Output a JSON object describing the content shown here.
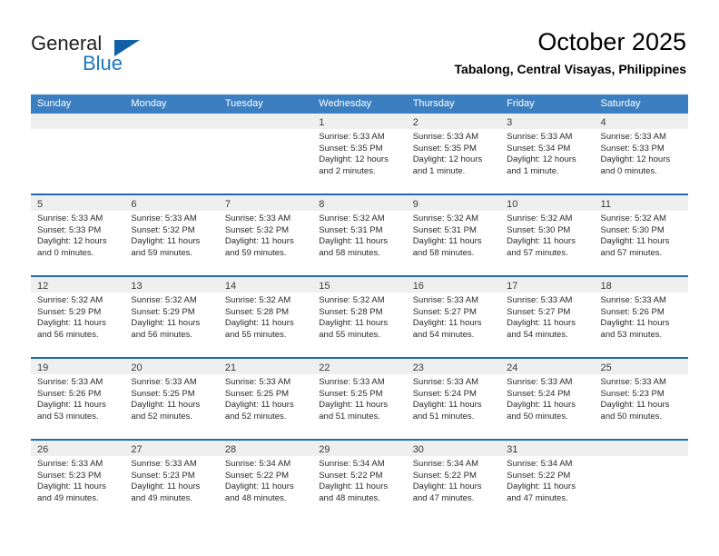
{
  "brand": {
    "name_part1": "General",
    "name_part2": "Blue",
    "triangle_color": "#1260a8",
    "blue_color": "#1c79c0"
  },
  "header": {
    "month_title": "October 2025",
    "location": "Tabalong, Central Visayas, Philippines"
  },
  "theme": {
    "header_row_bg": "#3c7fc1",
    "week_border": "#1f6cb0",
    "daynum_bg": "#efefef"
  },
  "weekday_headers": [
    "Sunday",
    "Monday",
    "Tuesday",
    "Wednesday",
    "Thursday",
    "Friday",
    "Saturday"
  ],
  "weeks": [
    [
      {
        "day": "",
        "empty": true,
        "sunrise": "",
        "sunset": "",
        "daylight1": "",
        "daylight2": ""
      },
      {
        "day": "",
        "empty": true,
        "sunrise": "",
        "sunset": "",
        "daylight1": "",
        "daylight2": ""
      },
      {
        "day": "",
        "empty": true,
        "sunrise": "",
        "sunset": "",
        "daylight1": "",
        "daylight2": ""
      },
      {
        "day": "1",
        "empty": false,
        "sunrise": "Sunrise: 5:33 AM",
        "sunset": "Sunset: 5:35 PM",
        "daylight1": "Daylight: 12 hours",
        "daylight2": "and 2 minutes."
      },
      {
        "day": "2",
        "empty": false,
        "sunrise": "Sunrise: 5:33 AM",
        "sunset": "Sunset: 5:35 PM",
        "daylight1": "Daylight: 12 hours",
        "daylight2": "and 1 minute."
      },
      {
        "day": "3",
        "empty": false,
        "sunrise": "Sunrise: 5:33 AM",
        "sunset": "Sunset: 5:34 PM",
        "daylight1": "Daylight: 12 hours",
        "daylight2": "and 1 minute."
      },
      {
        "day": "4",
        "empty": false,
        "sunrise": "Sunrise: 5:33 AM",
        "sunset": "Sunset: 5:33 PM",
        "daylight1": "Daylight: 12 hours",
        "daylight2": "and 0 minutes."
      }
    ],
    [
      {
        "day": "5",
        "empty": false,
        "sunrise": "Sunrise: 5:33 AM",
        "sunset": "Sunset: 5:33 PM",
        "daylight1": "Daylight: 12 hours",
        "daylight2": "and 0 minutes."
      },
      {
        "day": "6",
        "empty": false,
        "sunrise": "Sunrise: 5:33 AM",
        "sunset": "Sunset: 5:32 PM",
        "daylight1": "Daylight: 11 hours",
        "daylight2": "and 59 minutes."
      },
      {
        "day": "7",
        "empty": false,
        "sunrise": "Sunrise: 5:33 AM",
        "sunset": "Sunset: 5:32 PM",
        "daylight1": "Daylight: 11 hours",
        "daylight2": "and 59 minutes."
      },
      {
        "day": "8",
        "empty": false,
        "sunrise": "Sunrise: 5:32 AM",
        "sunset": "Sunset: 5:31 PM",
        "daylight1": "Daylight: 11 hours",
        "daylight2": "and 58 minutes."
      },
      {
        "day": "9",
        "empty": false,
        "sunrise": "Sunrise: 5:32 AM",
        "sunset": "Sunset: 5:31 PM",
        "daylight1": "Daylight: 11 hours",
        "daylight2": "and 58 minutes."
      },
      {
        "day": "10",
        "empty": false,
        "sunrise": "Sunrise: 5:32 AM",
        "sunset": "Sunset: 5:30 PM",
        "daylight1": "Daylight: 11 hours",
        "daylight2": "and 57 minutes."
      },
      {
        "day": "11",
        "empty": false,
        "sunrise": "Sunrise: 5:32 AM",
        "sunset": "Sunset: 5:30 PM",
        "daylight1": "Daylight: 11 hours",
        "daylight2": "and 57 minutes."
      }
    ],
    [
      {
        "day": "12",
        "empty": false,
        "sunrise": "Sunrise: 5:32 AM",
        "sunset": "Sunset: 5:29 PM",
        "daylight1": "Daylight: 11 hours",
        "daylight2": "and 56 minutes."
      },
      {
        "day": "13",
        "empty": false,
        "sunrise": "Sunrise: 5:32 AM",
        "sunset": "Sunset: 5:29 PM",
        "daylight1": "Daylight: 11 hours",
        "daylight2": "and 56 minutes."
      },
      {
        "day": "14",
        "empty": false,
        "sunrise": "Sunrise: 5:32 AM",
        "sunset": "Sunset: 5:28 PM",
        "daylight1": "Daylight: 11 hours",
        "daylight2": "and 55 minutes."
      },
      {
        "day": "15",
        "empty": false,
        "sunrise": "Sunrise: 5:32 AM",
        "sunset": "Sunset: 5:28 PM",
        "daylight1": "Daylight: 11 hours",
        "daylight2": "and 55 minutes."
      },
      {
        "day": "16",
        "empty": false,
        "sunrise": "Sunrise: 5:33 AM",
        "sunset": "Sunset: 5:27 PM",
        "daylight1": "Daylight: 11 hours",
        "daylight2": "and 54 minutes."
      },
      {
        "day": "17",
        "empty": false,
        "sunrise": "Sunrise: 5:33 AM",
        "sunset": "Sunset: 5:27 PM",
        "daylight1": "Daylight: 11 hours",
        "daylight2": "and 54 minutes."
      },
      {
        "day": "18",
        "empty": false,
        "sunrise": "Sunrise: 5:33 AM",
        "sunset": "Sunset: 5:26 PM",
        "daylight1": "Daylight: 11 hours",
        "daylight2": "and 53 minutes."
      }
    ],
    [
      {
        "day": "19",
        "empty": false,
        "sunrise": "Sunrise: 5:33 AM",
        "sunset": "Sunset: 5:26 PM",
        "daylight1": "Daylight: 11 hours",
        "daylight2": "and 53 minutes."
      },
      {
        "day": "20",
        "empty": false,
        "sunrise": "Sunrise: 5:33 AM",
        "sunset": "Sunset: 5:25 PM",
        "daylight1": "Daylight: 11 hours",
        "daylight2": "and 52 minutes."
      },
      {
        "day": "21",
        "empty": false,
        "sunrise": "Sunrise: 5:33 AM",
        "sunset": "Sunset: 5:25 PM",
        "daylight1": "Daylight: 11 hours",
        "daylight2": "and 52 minutes."
      },
      {
        "day": "22",
        "empty": false,
        "sunrise": "Sunrise: 5:33 AM",
        "sunset": "Sunset: 5:25 PM",
        "daylight1": "Daylight: 11 hours",
        "daylight2": "and 51 minutes."
      },
      {
        "day": "23",
        "empty": false,
        "sunrise": "Sunrise: 5:33 AM",
        "sunset": "Sunset: 5:24 PM",
        "daylight1": "Daylight: 11 hours",
        "daylight2": "and 51 minutes."
      },
      {
        "day": "24",
        "empty": false,
        "sunrise": "Sunrise: 5:33 AM",
        "sunset": "Sunset: 5:24 PM",
        "daylight1": "Daylight: 11 hours",
        "daylight2": "and 50 minutes."
      },
      {
        "day": "25",
        "empty": false,
        "sunrise": "Sunrise: 5:33 AM",
        "sunset": "Sunset: 5:23 PM",
        "daylight1": "Daylight: 11 hours",
        "daylight2": "and 50 minutes."
      }
    ],
    [
      {
        "day": "26",
        "empty": false,
        "sunrise": "Sunrise: 5:33 AM",
        "sunset": "Sunset: 5:23 PM",
        "daylight1": "Daylight: 11 hours",
        "daylight2": "and 49 minutes."
      },
      {
        "day": "27",
        "empty": false,
        "sunrise": "Sunrise: 5:33 AM",
        "sunset": "Sunset: 5:23 PM",
        "daylight1": "Daylight: 11 hours",
        "daylight2": "and 49 minutes."
      },
      {
        "day": "28",
        "empty": false,
        "sunrise": "Sunrise: 5:34 AM",
        "sunset": "Sunset: 5:22 PM",
        "daylight1": "Daylight: 11 hours",
        "daylight2": "and 48 minutes."
      },
      {
        "day": "29",
        "empty": false,
        "sunrise": "Sunrise: 5:34 AM",
        "sunset": "Sunset: 5:22 PM",
        "daylight1": "Daylight: 11 hours",
        "daylight2": "and 48 minutes."
      },
      {
        "day": "30",
        "empty": false,
        "sunrise": "Sunrise: 5:34 AM",
        "sunset": "Sunset: 5:22 PM",
        "daylight1": "Daylight: 11 hours",
        "daylight2": "and 47 minutes."
      },
      {
        "day": "31",
        "empty": false,
        "sunrise": "Sunrise: 5:34 AM",
        "sunset": "Sunset: 5:22 PM",
        "daylight1": "Daylight: 11 hours",
        "daylight2": "and 47 minutes."
      },
      {
        "day": "",
        "empty": true,
        "sunrise": "",
        "sunset": "",
        "daylight1": "",
        "daylight2": ""
      }
    ]
  ]
}
